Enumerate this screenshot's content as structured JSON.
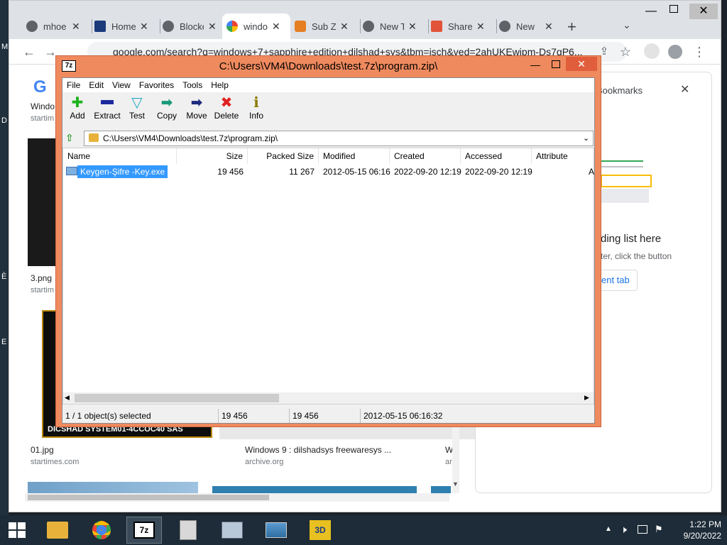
{
  "browser": {
    "tabs": [
      {
        "label": "mhoe",
        "color": "#5f6368"
      },
      {
        "label": "Home",
        "color": "#1a3a7a"
      },
      {
        "label": "Blocke",
        "color": "#5f6368"
      },
      {
        "label": "windo",
        "color": "#4285f4"
      },
      {
        "label": "Sub Z",
        "color": "#e67e22"
      },
      {
        "label": "New T",
        "color": "#5f6368"
      },
      {
        "label": "Share",
        "color": "#e2543a"
      },
      {
        "label": "New",
        "color": "#5f6368"
      }
    ],
    "address": "google.com/search?q=windows+7+sapphire+edition+dilshad+sys&tbm=isch&ved=2ahUKEwjpm-Ds7qP6...",
    "page": {
      "left_text_top": "Windo",
      "left_src_top": "startim",
      "img1_caption": "3.png",
      "img1_src": "startim",
      "img2_caption": "01.jpg",
      "img2_src": "startimes.com",
      "img3_caption": "Windows 9 : dilshadsys freewaresys ...",
      "img3_src": "archive.org",
      "img4_caption": "W",
      "img4_src": "ar",
      "banner_text": "DICSHAD SYSTEM01-4CCOC40 SAS"
    },
    "bookmarks_panel": {
      "title": "Bookmarks",
      "empty_title": "ding list here",
      "empty_sub": "ter, click the button",
      "button": "ent tab"
    }
  },
  "sevenzip": {
    "title": "C:\\Users\\VM4\\Downloads\\test.7z\\program.zip\\",
    "logo": "7z",
    "menu": [
      "File",
      "Edit",
      "View",
      "Favorites",
      "Tools",
      "Help"
    ],
    "tools": [
      {
        "label": "Add",
        "icon": "add-icon"
      },
      {
        "label": "Extract",
        "icon": "extract-icon"
      },
      {
        "label": "Test",
        "icon": "test-icon"
      },
      {
        "label": "Copy",
        "icon": "copy-icon"
      },
      {
        "label": "Move",
        "icon": "move-icon"
      },
      {
        "label": "Delete",
        "icon": "delete-icon"
      },
      {
        "label": "Info",
        "icon": "info-icon"
      }
    ],
    "path": "C:\\Users\\VM4\\Downloads\\test.7z\\program.zip\\",
    "columns": [
      "Name",
      "Size",
      "Packed Size",
      "Modified",
      "Created",
      "Accessed",
      "Attribute"
    ],
    "rows": [
      {
        "name": "Keygen-Şifre -Key.exe",
        "size": "19 456",
        "packed": "11 267",
        "modified": "2012-05-15 06:16",
        "created": "2022-09-20 12:19",
        "accessed": "2022-09-20 12:19",
        "attr": "A"
      }
    ],
    "status": {
      "selected": "1 / 1 object(s) selected",
      "size": "19 456",
      "packed": "19 456",
      "date": "2012-05-15 06:16:32"
    }
  },
  "taskbar": {
    "apps": [
      "file-explorer-icon",
      "chrome-icon",
      "7zip-icon",
      "archive-icon",
      "monitor-icon",
      "image-viewer-icon",
      "3d-app-icon"
    ],
    "clock_time": "1:22 PM",
    "clock_date": "9/20/2022"
  }
}
